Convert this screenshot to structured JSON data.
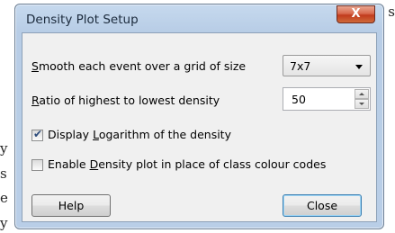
{
  "background_text": {
    "left": [
      "y",
      "s",
      "e",
      "y"
    ],
    "right": [
      "s"
    ]
  },
  "dialog": {
    "title": "Density Plot Setup",
    "close_glyph": "X"
  },
  "smooth": {
    "label_pre": "",
    "label_u": "S",
    "label_post": "mooth each event over a grid of size",
    "selected": "7x7"
  },
  "ratio": {
    "label_u": "R",
    "label_post": "atio of highest to lowest density",
    "value": "50"
  },
  "log": {
    "checked": true,
    "check_glyph": "✔",
    "label_pre": "Display ",
    "label_u": "L",
    "label_post": "ogarithm of the density"
  },
  "enable": {
    "checked": false,
    "label_pre": "Enable ",
    "label_u": "D",
    "label_post": "ensity plot in place of class colour codes"
  },
  "buttons": {
    "help": "Help",
    "close": "Close"
  },
  "colors": {
    "accent": "#3c7fb1",
    "close_red": "#c13b1d"
  }
}
